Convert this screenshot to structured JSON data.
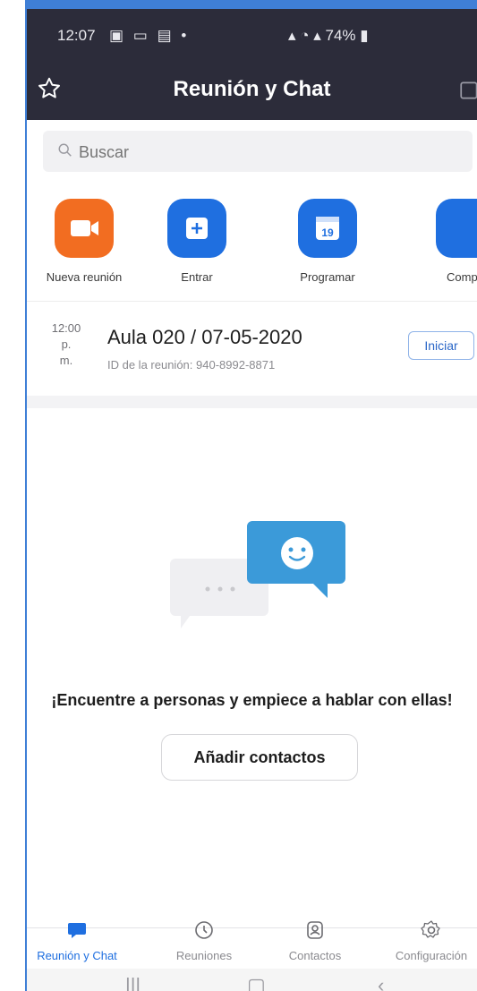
{
  "status": {
    "time": "12:07",
    "right": "74%"
  },
  "header": {
    "title": "Reunión y Chat"
  },
  "search": {
    "placeholder": "Buscar"
  },
  "actions": [
    {
      "label": "Nueva reunión",
      "icon": "video-camera-icon",
      "color": "#f26d21"
    },
    {
      "label": "Entrar",
      "icon": "plus-square-icon",
      "color": "#1f6fe0"
    },
    {
      "label": "Programar",
      "icon": "calendar-icon",
      "color": "#1f6fe0",
      "day": "19"
    },
    {
      "label": "Compa",
      "icon": "share-screen-icon",
      "color": "#1f6fe0"
    }
  ],
  "meeting": {
    "time_lines": [
      "12:00",
      "p.",
      "m."
    ],
    "title": "Aula 020 / 07-05-2020",
    "id_text": "ID de la reunión: 940-8992-8871",
    "start_label": "Iniciar"
  },
  "empty": {
    "message": "¡Encuentre a personas y empiece a hablar con ellas!",
    "add_label": "Añadir contactos"
  },
  "bottom_nav": [
    {
      "label": "Reunión y Chat",
      "icon": "chat-bubble-icon",
      "active": true
    },
    {
      "label": "Reuniones",
      "icon": "clock-icon",
      "active": false
    },
    {
      "label": "Contactos",
      "icon": "contacts-icon",
      "active": false
    },
    {
      "label": "Configuración",
      "icon": "gear-icon",
      "active": false
    }
  ],
  "colors": {
    "header_bg": "#2c2c3a",
    "accent_blue": "#1f6fe0",
    "accent_orange": "#f26d21"
  }
}
